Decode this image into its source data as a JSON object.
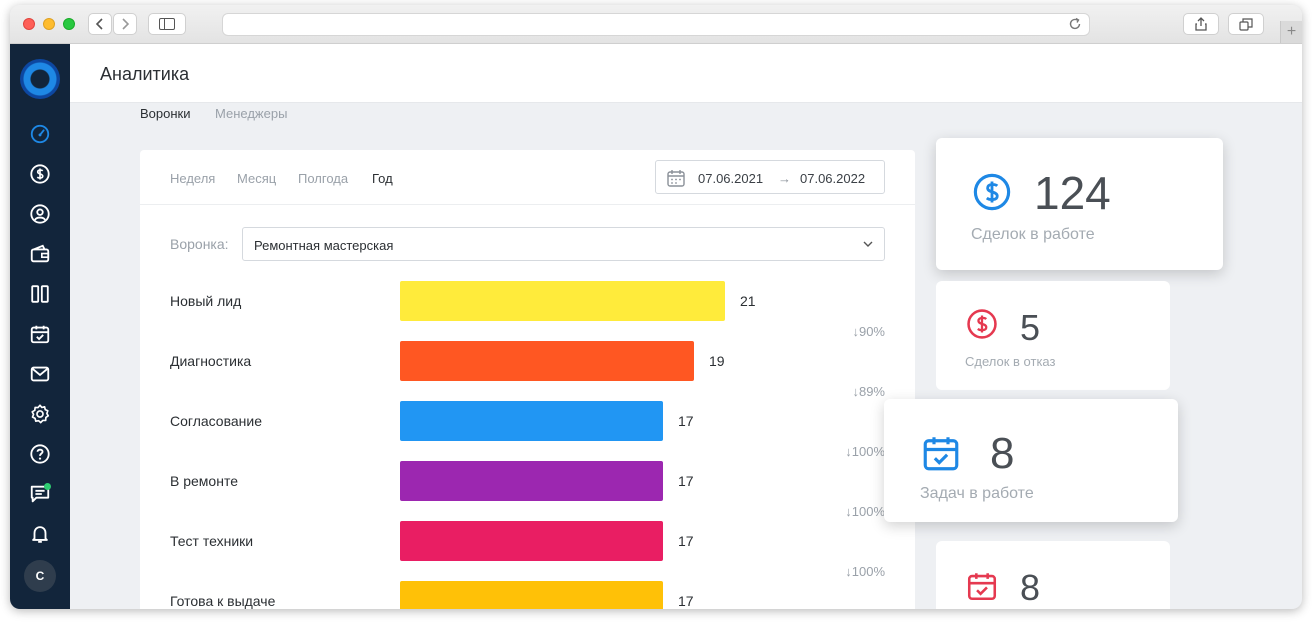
{
  "page": {
    "title": "Аналитика"
  },
  "subtabs": [
    {
      "label": "Воронки",
      "active": true
    },
    {
      "label": "Менеджеры",
      "active": false
    }
  ],
  "periods": [
    {
      "label": "Неделя",
      "active": false
    },
    {
      "label": "Месяц",
      "active": false
    },
    {
      "label": "Полгода",
      "active": false
    },
    {
      "label": "Год",
      "active": true
    }
  ],
  "date_range": {
    "from": "07.06.2021",
    "arrow": "→",
    "to": "07.06.2022"
  },
  "funnel": {
    "label": "Воронка:",
    "selected": "Ремонтная мастерская"
  },
  "stages": [
    {
      "name": "Новый лид",
      "count": 21,
      "color": "#ffeb3b",
      "conversion": "↓90%"
    },
    {
      "name": "Диагностика",
      "count": 19,
      "color": "#ff5722",
      "conversion": "↓89%"
    },
    {
      "name": "Согласование",
      "count": 17,
      "color": "#2196f3",
      "conversion": "↓100%"
    },
    {
      "name": "В ремонте",
      "count": 17,
      "color": "#9c27b0",
      "conversion": "↓100%"
    },
    {
      "name": "Тест техники",
      "count": 17,
      "color": "#e91e63",
      "conversion": "↓100%"
    },
    {
      "name": "Готова к выдаче",
      "count": 17,
      "color": "#ffc107",
      "conversion": ""
    }
  ],
  "cards": {
    "deals_active": {
      "value": "124",
      "caption": "Сделок в работе",
      "icon": "dollar-circle-icon",
      "color": "#1e88e5"
    },
    "deals_rejected": {
      "value": "5",
      "caption": "Сделок в отказ",
      "icon": "dollar-circle-icon",
      "color": "#e53950"
    },
    "tasks_active": {
      "value": "8",
      "caption": "Задач в работе",
      "icon": "calendar-check-icon",
      "color": "#1e88e5"
    },
    "tasks_overdue": {
      "value": "8",
      "caption": "",
      "icon": "calendar-check-icon",
      "color": "#e53950"
    }
  },
  "sidebar": {
    "avatar_initial": "C",
    "icons": [
      "dashboard-icon",
      "dollar-icon",
      "user-icon",
      "wallet-icon",
      "columns-icon",
      "calendar-icon",
      "mail-icon",
      "settings-icon",
      "help-icon",
      "chat-icon",
      "bell-icon"
    ]
  }
}
